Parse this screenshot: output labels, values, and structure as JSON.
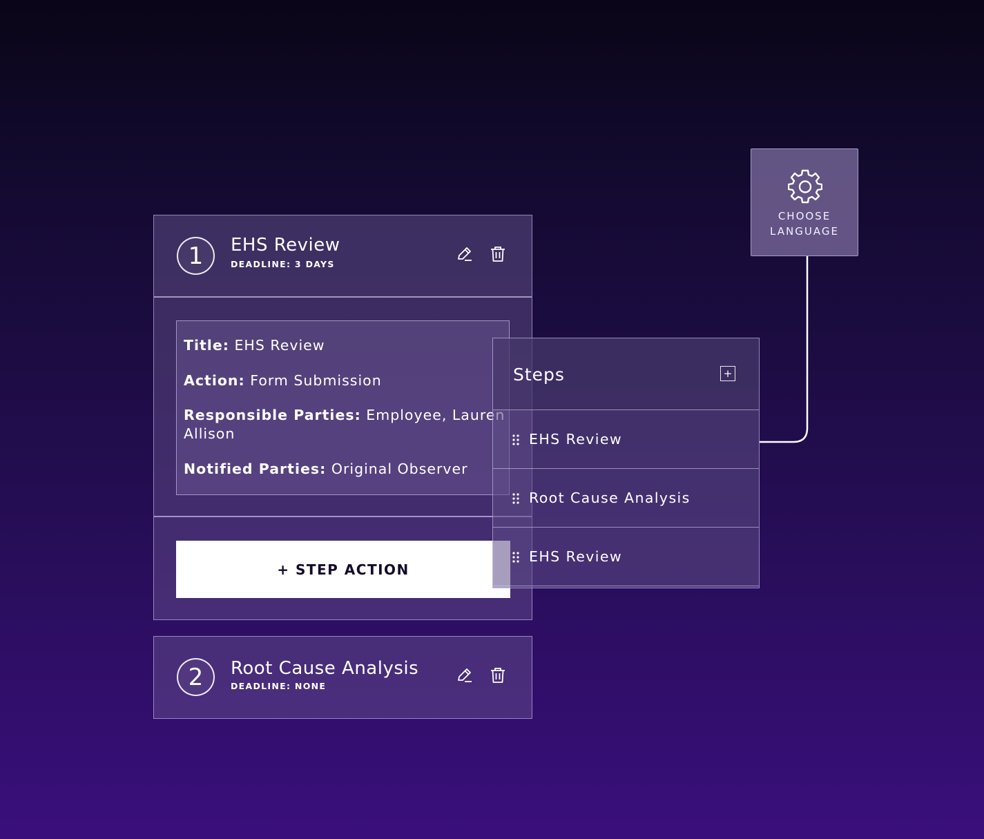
{
  "steps": [
    {
      "number": "1",
      "title": "EHS Review",
      "deadline": "DEADLINE: 3 DAYS",
      "details": {
        "title_label": "Title:",
        "title_value": "EHS Review",
        "action_label": "Action:",
        "action_value": "Form Submission",
        "responsible_label": "Responsible Parties:",
        "responsible_value_line1": "Employee, Lauren",
        "responsible_value_line2": "Allison",
        "notified_label": "Notified Parties:",
        "notified_value": "Original Observer"
      },
      "action_button": "+ STEP ACTION"
    },
    {
      "number": "2",
      "title": "Root Cause Analysis",
      "deadline": "DEADLINE: NONE"
    }
  ],
  "steps_panel": {
    "title": "Steps",
    "add_icon": "plus-square-icon",
    "items": [
      {
        "label": "EHS Review"
      },
      {
        "label": "Root Cause Analysis"
      },
      {
        "label": "EHS Review"
      }
    ]
  },
  "language_button": {
    "line1": "CHOOSE",
    "line2": "LANGUAGE",
    "icon": "gear-icon"
  },
  "icons": {
    "edit": "pencil-icon",
    "delete": "trash-icon",
    "drag": "drag-handle-icon"
  },
  "colors": {
    "background_top": "#0a0517",
    "background_bottom": "#3a0f7c",
    "button_bg": "#ffffff",
    "button_text": "#140a2a"
  }
}
